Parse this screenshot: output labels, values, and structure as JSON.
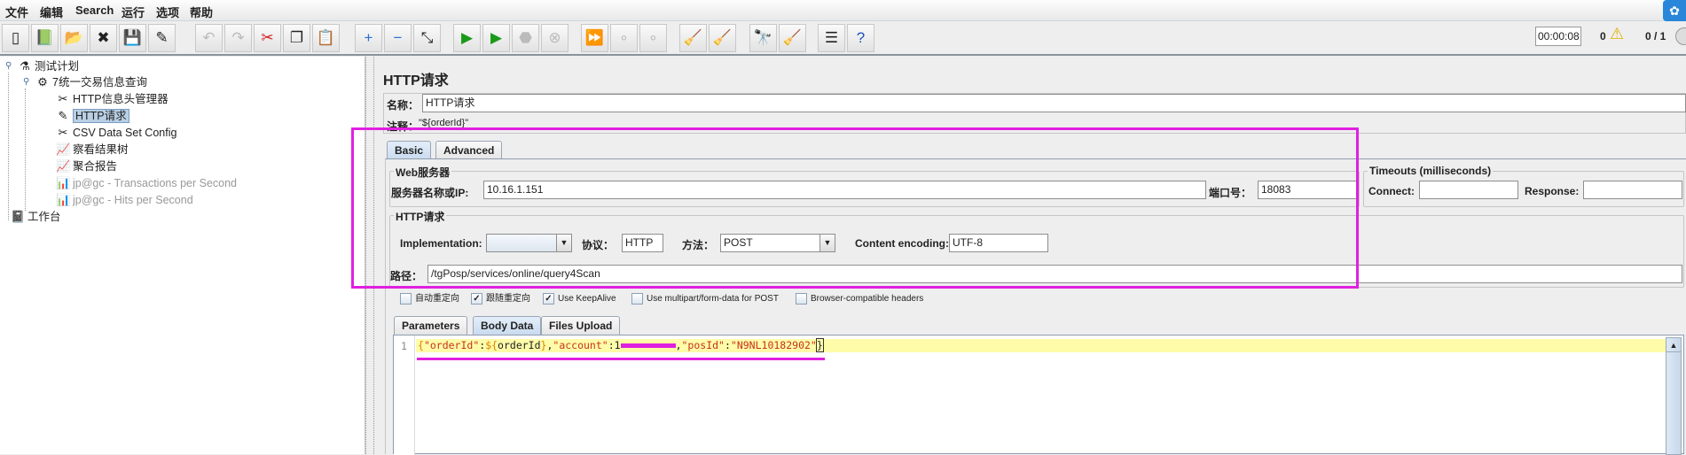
{
  "menu": [
    "文件",
    "编辑",
    "Search",
    "运行",
    "选项",
    "帮助"
  ],
  "toolbar": {
    "buttons": [
      "new-icon",
      "templates-icon",
      "open-icon",
      "close-icon",
      "save-icon",
      "save-screenshot-icon",
      "undo-icon",
      "redo-icon",
      "cut-icon",
      "copy-icon",
      "paste-icon",
      "expand-icon",
      "collapse-icon",
      "toggle-icon",
      "start-icon",
      "start-no-pauses-icon",
      "stop-icon",
      "shutdown-icon",
      "remote-start-all-icon",
      "remote-stop-all-icon",
      "remote-shutdown-all-icon",
      "clear-icon",
      "clear-all-icon",
      "search-icon",
      "reset-search-icon",
      "function-helper-icon",
      "help-icon"
    ],
    "timer": "00:00:08",
    "warnings": "0",
    "threads": "0 / 1"
  },
  "tree": {
    "items": [
      {
        "label": "测试计划",
        "level": 0
      },
      {
        "label": "7统一交易信息查询",
        "level": 1
      },
      {
        "label": "HTTP信息头管理器",
        "level": 2
      },
      {
        "label": "HTTP请求",
        "level": 2,
        "selected": true
      },
      {
        "label": "CSV Data Set Config",
        "level": 2
      },
      {
        "label": "察看结果树",
        "level": 2
      },
      {
        "label": "聚合报告",
        "level": 2
      },
      {
        "label": "jp@gc - Transactions per Second",
        "level": 2,
        "disabled": true
      },
      {
        "label": "jp@gc - Hits per Second",
        "level": 2,
        "disabled": true
      },
      {
        "label": "工作台",
        "level": 0
      }
    ]
  },
  "panel": {
    "title": "HTTP请求",
    "name_label": "名称：",
    "name_value": "HTTP请求",
    "comment_label": "注释：",
    "comment_value": "\"${orderId}\"",
    "tabs": [
      "Basic",
      "Advanced"
    ],
    "web_server": {
      "legend": "Web服务器",
      "server_label": "服务器名称或IP:",
      "server_value": "10.16.1.151",
      "port_label": "端口号：",
      "port_value": "18083"
    },
    "timeouts": {
      "legend": "Timeouts (milliseconds)",
      "connect_label": "Connect:",
      "connect_value": "",
      "response_label": "Response:",
      "response_value": ""
    },
    "http": {
      "legend": "HTTP请求",
      "impl_label": "Implementation:",
      "impl_value": "",
      "protocol_label": "协议：",
      "protocol_value": "HTTP",
      "method_label": "方法：",
      "method_value": "POST",
      "encoding_label": "Content encoding:",
      "encoding_value": "UTF-8",
      "path_label": "路径：",
      "path_value": "/tgPosp/services/online/query4Scan"
    },
    "checkboxes": [
      {
        "label": "自动重定向",
        "checked": false
      },
      {
        "label": "跟随重定向",
        "checked": true
      },
      {
        "label": "Use KeepAlive",
        "checked": true
      },
      {
        "label": "Use multipart/form-data for POST",
        "checked": false
      },
      {
        "label": "Browser-compatible headers",
        "checked": false
      }
    ],
    "body_tabs": [
      "Parameters",
      "Body Data",
      "Files Upload"
    ],
    "code": {
      "line_number": "1",
      "p1": "{",
      "p2": "\"orderId\"",
      "p2b": ":",
      "p3": "${",
      "p4": "orderId",
      "p5": "}",
      "p5b": ",",
      "p6": "\"account\"",
      "p7": ":1",
      "p8": ",",
      "p9": "\"posId\"",
      "p10": ":",
      "p11": "\"N9NL10182902\"",
      "p12": "}"
    }
  },
  "annotation_color": "#e020e0"
}
